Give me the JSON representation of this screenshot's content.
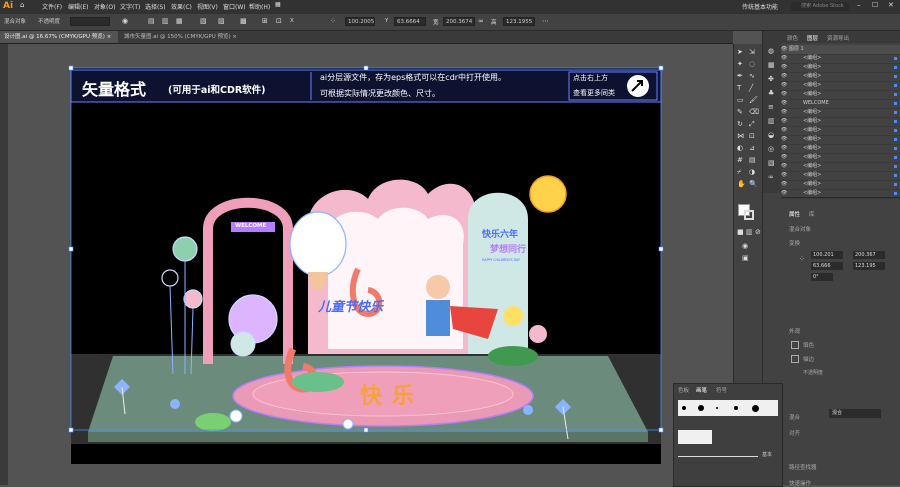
{
  "app": {
    "logo": "Ai"
  },
  "menu": [
    "文件(F)",
    "编辑(E)",
    "对象(O)",
    "文字(T)",
    "选择(S)",
    "效果(C)",
    "视图(V)",
    "窗口(W)",
    "帮助(H)"
  ],
  "workspace": {
    "label": "传统基本功能",
    "search_placeholder": "搜索 Adobe Stock"
  },
  "control_bar": {
    "selection_label": "混合对象",
    "opacity_label": "不透明度",
    "x_label": "X",
    "x_value": "100.2005",
    "y_label": "Y",
    "y_value": "63.6664",
    "w_label": "宽",
    "w_value": "200.3674",
    "h_label": "高",
    "h_value": "123.1955"
  },
  "doc_tabs": [
    {
      "label": "设计图.ai @ 16.67% (CMYK/GPU 预览)",
      "active": true
    },
    {
      "label": "城市矢量图.ai @ 150% (CMYK/GPU 预览)",
      "active": false
    }
  ],
  "artboard": {
    "banner_title": "矢量格式",
    "banner_title_sub": "(可用于ai和CDR软件)",
    "banner_line1": "ai分层源文件，存为eps格式可以在cdr中打开使用。",
    "banner_line2": "可根据实际情况更改颜色、尺寸。",
    "banner_cta1": "点击右上方",
    "banner_cta2": "查看更多同类",
    "welcome_sign": "WELCOME",
    "arch_text1": "快乐六年",
    "arch_text2": "梦想同行",
    "arch_small": "HAPPY CHILDREN'S DAY",
    "main_text": "儿童节快乐",
    "floor_text": "快乐",
    "number_six": "6"
  },
  "right_panel": {
    "tabs": [
      "颜色",
      "图层",
      "资源导出"
    ],
    "top_layer": "图层 1",
    "layers": [
      "<编组>",
      "<编组>",
      "<编组>",
      "<编组>",
      "<编组>",
      "WELCOME",
      "<编组>",
      "<编组>",
      "<编组>",
      "<编组>",
      "<编组>",
      "<编组>",
      "<编组>",
      "<编组>",
      "<编组>",
      "<编组>"
    ],
    "props_tabs": [
      "属性",
      "库"
    ],
    "props_section_mix": "混合对象",
    "transform_label": "变换",
    "x_value": "100.201",
    "w_value": "200.367",
    "y_value": "63.666",
    "h_value": "123.195",
    "angle_value": "0°",
    "appearance_label": "外观",
    "fill_label": "填色",
    "stroke_label": "描边",
    "opacity_label": "不透明度",
    "blend_label": "混合",
    "blend_mode": "混合",
    "align_label": "对齐",
    "quick_actions": "快速操作",
    "pathfinder_label": "路径查找器"
  },
  "brush_panel": {
    "tabs": [
      "色板",
      "画笔",
      "符号"
    ],
    "stroke_label": "基本"
  },
  "colors": {
    "accent_blue": "#4a8cff",
    "banner_text": "#ffffff",
    "artboard_bg": "#000000"
  }
}
